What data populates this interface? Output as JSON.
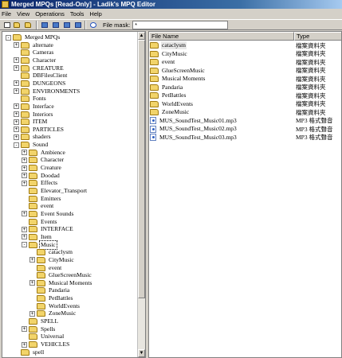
{
  "window": {
    "title": "Merged MPQs [Read-Only] - Ladik's MPQ Editor"
  },
  "menu": [
    "File",
    "View",
    "Operations",
    "Tools",
    "Help"
  ],
  "toolbar": {
    "buttons": [
      "new-file",
      "open-folder",
      "save",
      "view-tree",
      "view-list",
      "view-details",
      "view-icons",
      "info"
    ],
    "file_mask_label": "File mask:",
    "file_mask_value": "*"
  },
  "tree": {
    "items": [
      {
        "label": "Merged MPQs",
        "depth": 0,
        "expander": "-"
      },
      {
        "label": "alternate",
        "depth": 1,
        "expander": "+"
      },
      {
        "label": "Cameras",
        "depth": 1,
        "expander": ""
      },
      {
        "label": "Character",
        "depth": 1,
        "expander": "+"
      },
      {
        "label": "CREATURE",
        "depth": 1,
        "expander": "+"
      },
      {
        "label": "DBFilesClient",
        "depth": 1,
        "expander": ""
      },
      {
        "label": "DUNGEONS",
        "depth": 1,
        "expander": "+"
      },
      {
        "label": "ENVIRONMENTS",
        "depth": 1,
        "expander": "+"
      },
      {
        "label": "Fonts",
        "depth": 1,
        "expander": ""
      },
      {
        "label": "Interface",
        "depth": 1,
        "expander": "+"
      },
      {
        "label": "Interiors",
        "depth": 1,
        "expander": "+"
      },
      {
        "label": "ITEM",
        "depth": 1,
        "expander": "+"
      },
      {
        "label": "PARTICLES",
        "depth": 1,
        "expander": "+"
      },
      {
        "label": "shaders",
        "depth": 1,
        "expander": "+"
      },
      {
        "label": "Sound",
        "depth": 1,
        "expander": "-"
      },
      {
        "label": "Ambience",
        "depth": 2,
        "expander": "+"
      },
      {
        "label": "Character",
        "depth": 2,
        "expander": "+"
      },
      {
        "label": "Creature",
        "depth": 2,
        "expander": "+"
      },
      {
        "label": "Doodad",
        "depth": 2,
        "expander": "+"
      },
      {
        "label": "Effects",
        "depth": 2,
        "expander": "+"
      },
      {
        "label": "Elevator_Transport",
        "depth": 2,
        "expander": ""
      },
      {
        "label": "Emitters",
        "depth": 2,
        "expander": ""
      },
      {
        "label": "event",
        "depth": 2,
        "expander": ""
      },
      {
        "label": "Event Sounds",
        "depth": 2,
        "expander": "+"
      },
      {
        "label": "Events",
        "depth": 2,
        "expander": ""
      },
      {
        "label": "INTERFACE",
        "depth": 2,
        "expander": "+"
      },
      {
        "label": "Item",
        "depth": 2,
        "expander": "+"
      },
      {
        "label": "Music",
        "depth": 2,
        "expander": "-",
        "selected": true
      },
      {
        "label": "cataclysm",
        "depth": 3,
        "expander": ""
      },
      {
        "label": "CityMusic",
        "depth": 3,
        "expander": "+"
      },
      {
        "label": "event",
        "depth": 3,
        "expander": ""
      },
      {
        "label": "GlueScreenMusic",
        "depth": 3,
        "expander": ""
      },
      {
        "label": "Musical Moments",
        "depth": 3,
        "expander": "+"
      },
      {
        "label": "Pandaria",
        "depth": 3,
        "expander": ""
      },
      {
        "label": "PetBattles",
        "depth": 3,
        "expander": ""
      },
      {
        "label": "WorldEvents",
        "depth": 3,
        "expander": ""
      },
      {
        "label": "ZoneMusic",
        "depth": 3,
        "expander": "+"
      },
      {
        "label": "SPELL",
        "depth": 2,
        "expander": ""
      },
      {
        "label": "Spells",
        "depth": 2,
        "expander": "+"
      },
      {
        "label": "Universal",
        "depth": 2,
        "expander": ""
      },
      {
        "label": "VEHICLES",
        "depth": 2,
        "expander": "+"
      },
      {
        "label": "spell",
        "depth": 1,
        "expander": ""
      }
    ]
  },
  "list": {
    "columns": [
      "File Name",
      "Type"
    ],
    "rows": [
      {
        "name": "cataclysm",
        "type": "檔案資料夾",
        "kind": "folder",
        "selected": true
      },
      {
        "name": "CityMusic",
        "type": "檔案資料夾",
        "kind": "folder"
      },
      {
        "name": "event",
        "type": "檔案資料夾",
        "kind": "folder"
      },
      {
        "name": "GlueScreenMusic",
        "type": "檔案資料夾",
        "kind": "folder"
      },
      {
        "name": "Musical Moments",
        "type": "檔案資料夾",
        "kind": "folder"
      },
      {
        "name": "Pandaria",
        "type": "檔案資料夾",
        "kind": "folder"
      },
      {
        "name": "PetBattles",
        "type": "檔案資料夾",
        "kind": "folder"
      },
      {
        "name": "WorldEvents",
        "type": "檔案資料夾",
        "kind": "folder"
      },
      {
        "name": "ZoneMusic",
        "type": "檔案資料夾",
        "kind": "folder"
      },
      {
        "name": "MUS_SoundTest_Music01.mp3",
        "type": "MP3 格式聲音",
        "kind": "mp3"
      },
      {
        "name": "MUS_SoundTest_Music02.mp3",
        "type": "MP3 格式聲音",
        "kind": "mp3"
      },
      {
        "name": "MUS_SoundTest_Music03.mp3",
        "type": "MP3 格式聲音",
        "kind": "mp3"
      }
    ]
  }
}
